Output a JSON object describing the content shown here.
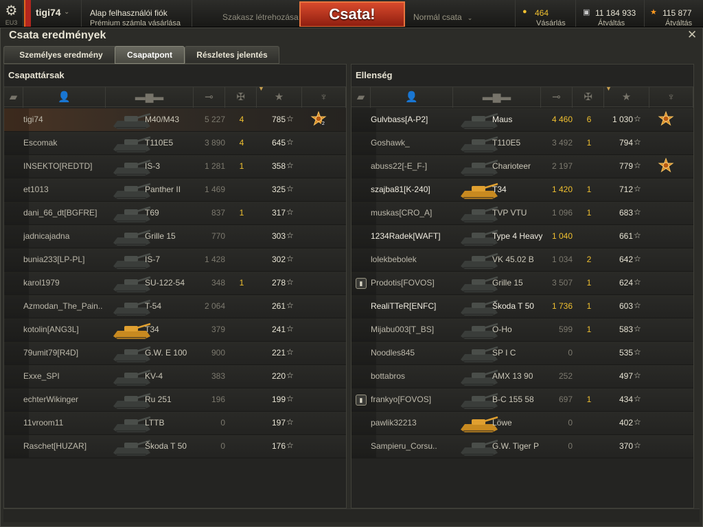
{
  "topbar": {
    "gear_icon": "gear-icon",
    "server": "EU3",
    "username": "tigi74",
    "account_type": "Alap felhasználói fiók",
    "premium_link": "Prémium számla vásárlása",
    "platoon": "Szakasz létrehozása",
    "battle_button": "Csata!",
    "battle_mode": "Normál csata",
    "gold": {
      "value": "464",
      "label": "Vásárlás",
      "icon": "gold-coin-icon"
    },
    "credits": {
      "value": "11 184 933",
      "label": "Átváltás",
      "icon": "credits-icon"
    },
    "freexp": {
      "value": "115 877",
      "label": "Átváltás",
      "icon": "star-icon"
    }
  },
  "window": {
    "title": "Csata eredmények",
    "close_icon": "close-icon",
    "tabs": [
      {
        "label": "Személyes eredmény",
        "active": false
      },
      {
        "label": "Csapatpont",
        "active": true
      },
      {
        "label": "Részletes jelentés",
        "active": false
      }
    ]
  },
  "columns": {
    "icons": [
      "platoon-icon",
      "player-icon",
      "tank-icon",
      "damage-icon",
      "kills-icon",
      "xp-star-icon",
      "medal-icon"
    ],
    "sort": "xp"
  },
  "allies": {
    "title": "Csapattársak",
    "rows": [
      {
        "name": "tigi74",
        "tank": "M40/M43",
        "damage": "5 227",
        "kills": "4",
        "xp": "785",
        "medal": true,
        "medal_count": "2",
        "self": true,
        "bold": false,
        "platoon": false,
        "tank_color": "dark"
      },
      {
        "name": "Escomak",
        "tank": "T110E5",
        "damage": "3 890",
        "kills": "4",
        "xp": "645",
        "medal": false,
        "medal_count": "",
        "self": false,
        "bold": false,
        "platoon": false,
        "tank_color": "dark"
      },
      {
        "name": "INSEKTO[REDTD]",
        "tank": "IS-3",
        "damage": "1 281",
        "kills": "1",
        "xp": "358",
        "medal": false,
        "medal_count": "",
        "self": false,
        "bold": false,
        "platoon": false,
        "tank_color": "dark"
      },
      {
        "name": "et1013",
        "tank": "Panther II",
        "damage": "1 469",
        "kills": "",
        "xp": "325",
        "medal": false,
        "medal_count": "",
        "self": false,
        "bold": false,
        "platoon": false,
        "tank_color": "dark"
      },
      {
        "name": "dani_66_dt[BGFRE]",
        "tank": "T69",
        "damage": "837",
        "kills": "1",
        "xp": "317",
        "medal": false,
        "medal_count": "",
        "self": false,
        "bold": false,
        "platoon": false,
        "tank_color": "dark"
      },
      {
        "name": "jadnicajadna",
        "tank": "Grille 15",
        "damage": "770",
        "kills": "",
        "xp": "303",
        "medal": false,
        "medal_count": "",
        "self": false,
        "bold": false,
        "platoon": false,
        "tank_color": "dark"
      },
      {
        "name": "bunia233[LP-PL]",
        "tank": "IS-7",
        "damage": "1 428",
        "kills": "",
        "xp": "302",
        "medal": false,
        "medal_count": "",
        "self": false,
        "bold": false,
        "platoon": false,
        "tank_color": "dark"
      },
      {
        "name": "karol1979",
        "tank": "SU-122-54",
        "damage": "348",
        "kills": "1",
        "xp": "278",
        "medal": false,
        "medal_count": "",
        "self": false,
        "bold": false,
        "platoon": false,
        "tank_color": "dark"
      },
      {
        "name": "Azmodan_The_Pain..",
        "tank": "T-54",
        "damage": "2 064",
        "kills": "",
        "xp": "261",
        "medal": false,
        "medal_count": "",
        "self": false,
        "bold": false,
        "platoon": false,
        "tank_color": "dark"
      },
      {
        "name": "kotolin[ANG3L]",
        "tank": "T34",
        "damage": "379",
        "kills": "",
        "xp": "241",
        "medal": false,
        "medal_count": "",
        "self": false,
        "bold": false,
        "platoon": false,
        "tank_color": "gold"
      },
      {
        "name": "79umit79[R4D]",
        "tank": "G.W. E 100",
        "damage": "900",
        "kills": "",
        "xp": "221",
        "medal": false,
        "medal_count": "",
        "self": false,
        "bold": false,
        "platoon": false,
        "tank_color": "dark"
      },
      {
        "name": "Exxe_SPI",
        "tank": "KV-4",
        "damage": "383",
        "kills": "",
        "xp": "220",
        "medal": false,
        "medal_count": "",
        "self": false,
        "bold": false,
        "platoon": false,
        "tank_color": "dark"
      },
      {
        "name": "echterWikinger",
        "tank": "Ru 251",
        "damage": "196",
        "kills": "",
        "xp": "199",
        "medal": false,
        "medal_count": "",
        "self": false,
        "bold": false,
        "platoon": false,
        "tank_color": "dark"
      },
      {
        "name": "11vroom11",
        "tank": "LTTB",
        "damage": "0",
        "kills": "",
        "xp": "197",
        "medal": false,
        "medal_count": "",
        "self": false,
        "bold": false,
        "platoon": false,
        "tank_color": "dark"
      },
      {
        "name": "Raschet[HUZAR]",
        "tank": "Škoda T 50",
        "damage": "0",
        "kills": "",
        "xp": "176",
        "medal": false,
        "medal_count": "",
        "self": false,
        "bold": false,
        "platoon": false,
        "tank_color": "dark"
      }
    ]
  },
  "enemies": {
    "title": "Ellenség",
    "rows": [
      {
        "name": "Gulvbass[A-P2]",
        "tank": "Maus",
        "damage": "4 460",
        "kills": "6",
        "xp": "1 030",
        "medal": true,
        "medal_count": "",
        "self": false,
        "bold": true,
        "platoon": false,
        "tank_color": "dark"
      },
      {
        "name": "Goshawk_",
        "tank": "T110E5",
        "damage": "3 492",
        "kills": "1",
        "xp": "794",
        "medal": false,
        "medal_count": "",
        "self": false,
        "bold": false,
        "platoon": false,
        "tank_color": "dark"
      },
      {
        "name": "abuss22[-E_F-]",
        "tank": "Charioteer",
        "damage": "2 197",
        "kills": "",
        "xp": "779",
        "medal": true,
        "medal_count": "",
        "self": false,
        "bold": false,
        "platoon": false,
        "tank_color": "dark"
      },
      {
        "name": "szajba81[K-240]",
        "tank": "T34",
        "damage": "1 420",
        "kills": "1",
        "xp": "712",
        "medal": false,
        "medal_count": "",
        "self": false,
        "bold": true,
        "platoon": false,
        "tank_color": "gold"
      },
      {
        "name": "muskas[CRO_A]",
        "tank": "TVP VTU",
        "damage": "1 096",
        "kills": "1",
        "xp": "683",
        "medal": false,
        "medal_count": "",
        "self": false,
        "bold": false,
        "platoon": false,
        "tank_color": "dark"
      },
      {
        "name": "1234Radek[WAFT]",
        "tank": "Type 4 Heavy",
        "damage": "1 040",
        "kills": "",
        "xp": "661",
        "medal": false,
        "medal_count": "",
        "self": false,
        "bold": true,
        "platoon": false,
        "tank_color": "dark"
      },
      {
        "name": "lolekbebolek",
        "tank": "VK 45.02 B",
        "damage": "1 034",
        "kills": "2",
        "xp": "642",
        "medal": false,
        "medal_count": "",
        "self": false,
        "bold": false,
        "platoon": false,
        "tank_color": "dark"
      },
      {
        "name": "Prodotis[FOVOS]",
        "tank": "Grille 15",
        "damage": "3 507",
        "kills": "1",
        "xp": "624",
        "medal": false,
        "medal_count": "",
        "self": false,
        "bold": false,
        "platoon": true,
        "tank_color": "dark"
      },
      {
        "name": "RealiTTeR[ENFC]",
        "tank": "Škoda T 50",
        "damage": "1 736",
        "kills": "1",
        "xp": "603",
        "medal": false,
        "medal_count": "",
        "self": false,
        "bold": true,
        "platoon": false,
        "tank_color": "dark"
      },
      {
        "name": "Mijabu003[T_BS]",
        "tank": "O-Ho",
        "damage": "599",
        "kills": "1",
        "xp": "583",
        "medal": false,
        "medal_count": "",
        "self": false,
        "bold": false,
        "platoon": false,
        "tank_color": "dark"
      },
      {
        "name": "Noodles845",
        "tank": "SP I C",
        "damage": "0",
        "kills": "",
        "xp": "535",
        "medal": false,
        "medal_count": "",
        "self": false,
        "bold": false,
        "platoon": false,
        "tank_color": "dark"
      },
      {
        "name": "bottabros",
        "tank": "AMX 13 90",
        "damage": "252",
        "kills": "",
        "xp": "497",
        "medal": false,
        "medal_count": "",
        "self": false,
        "bold": false,
        "platoon": false,
        "tank_color": "dark"
      },
      {
        "name": "frankyo[FOVOS]",
        "tank": "B-C 155 58",
        "damage": "697",
        "kills": "1",
        "xp": "434",
        "medal": false,
        "medal_count": "",
        "self": false,
        "bold": false,
        "platoon": true,
        "tank_color": "dark"
      },
      {
        "name": "pawlik32213",
        "tank": "Löwe",
        "damage": "0",
        "kills": "",
        "xp": "402",
        "medal": false,
        "medal_count": "",
        "self": false,
        "bold": false,
        "platoon": false,
        "tank_color": "gold"
      },
      {
        "name": "Sampieru_Corsu..",
        "tank": "G.W. Tiger P",
        "damage": "0",
        "kills": "",
        "xp": "370",
        "medal": false,
        "medal_count": "",
        "self": false,
        "bold": false,
        "platoon": false,
        "tank_color": "dark"
      }
    ]
  },
  "colors": {
    "accent": "#f0c030",
    "battle_button": "#c8361e",
    "self_row": "#4a3424"
  }
}
